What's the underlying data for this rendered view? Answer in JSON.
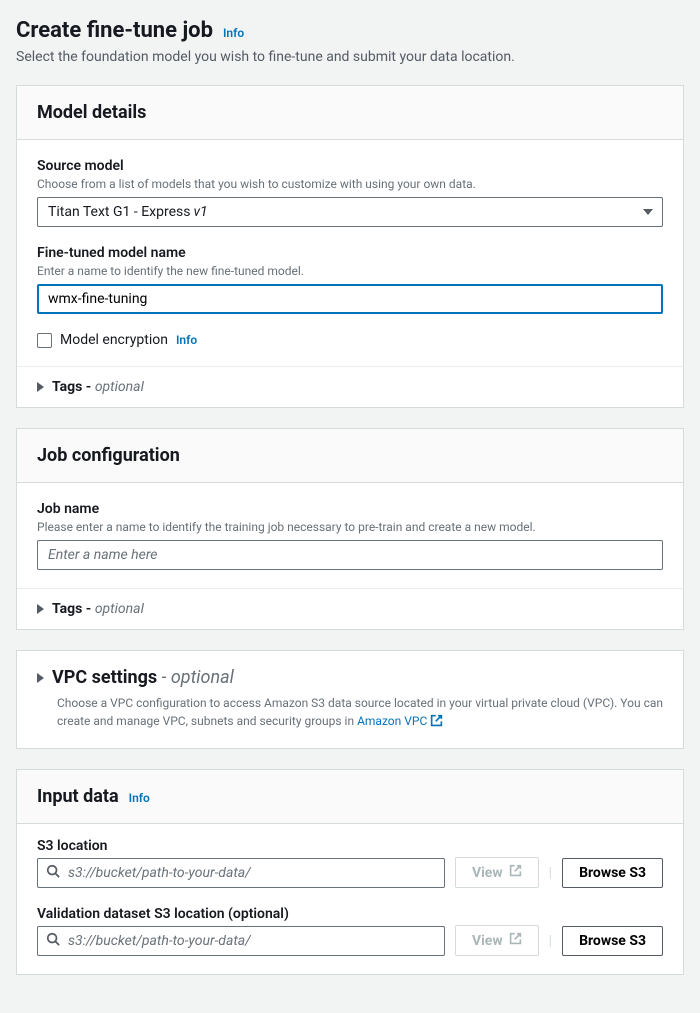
{
  "page": {
    "title": "Create fine-tune job",
    "info_label": "Info",
    "subtitle": "Select the foundation model you wish to fine-tune and submit your data location."
  },
  "model_details": {
    "panel_title": "Model details",
    "source_model": {
      "label": "Source model",
      "hint": "Choose from a list of models that you wish to customize with using your own data.",
      "selected_base": "Titan Text G1 - Express",
      "selected_version": "v1"
    },
    "model_name": {
      "label": "Fine-tuned model name",
      "hint": "Enter a name to identify the new fine-tuned model.",
      "value": "wmx-fine-tuning"
    },
    "encryption": {
      "label": "Model encryption",
      "info_label": "Info",
      "checked": false
    },
    "tags": {
      "label": "Tags -",
      "optional": "optional"
    }
  },
  "job_config": {
    "panel_title": "Job configuration",
    "job_name": {
      "label": "Job name",
      "hint": "Please enter a name to identify the training job necessary to pre-train and create a new model.",
      "placeholder": "Enter a name here",
      "value": ""
    },
    "tags": {
      "label": "Tags -",
      "optional": "optional"
    }
  },
  "vpc": {
    "title": "VPC settings",
    "optional_dash": " - ",
    "optional": "optional",
    "desc_prefix": "Choose a VPC configuration to access Amazon S3 data source located in your virtual private cloud (VPC). You can create and manage VPC, subnets and security groups in ",
    "link_text": "Amazon VPC"
  },
  "input_data": {
    "panel_title": "Input data",
    "info_label": "Info",
    "s3": {
      "label": "S3 location",
      "placeholder": "s3://bucket/path-to-your-data/",
      "value": "",
      "view_btn": "View",
      "browse_btn": "Browse S3"
    },
    "validation": {
      "label": "Validation dataset S3 location (optional)",
      "placeholder": "s3://bucket/path-to-your-data/",
      "value": "",
      "view_btn": "View",
      "browse_btn": "Browse S3"
    }
  }
}
